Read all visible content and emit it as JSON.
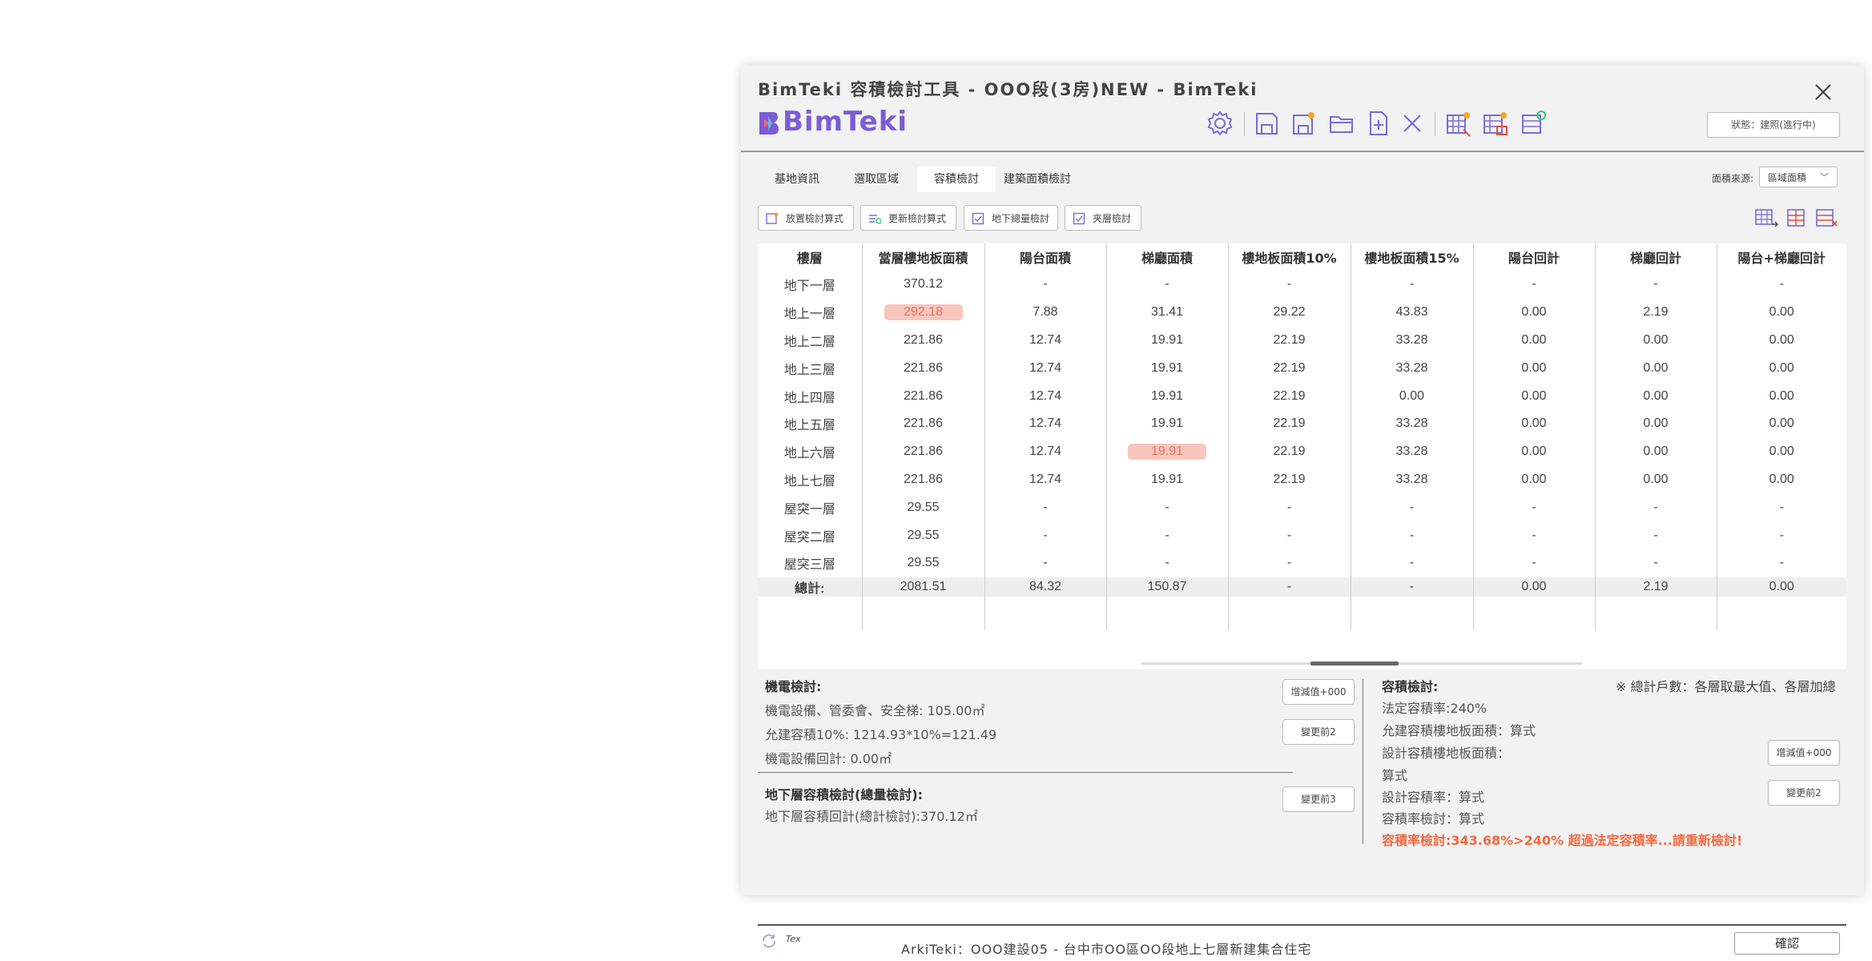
{
  "window": {
    "title": "BimTeki 容積檢討工具 - OOO段(3房)NEW - BimTeki",
    "logo_text": "BimTeki",
    "status": "狀態：建照(進行中)"
  },
  "tabs": [
    {
      "label": "基地資訊"
    },
    {
      "label": "選取區域"
    },
    {
      "label": "容積檢討"
    },
    {
      "label": "建築面積檢討"
    }
  ],
  "area_source": {
    "label": "面積來源:",
    "value": "區域面積"
  },
  "actions": [
    {
      "label": "放置檢討算式"
    },
    {
      "label": "更新檢討算式"
    },
    {
      "label": "地下總量檢討"
    },
    {
      "label": "夾層檢討"
    }
  ],
  "table": {
    "headers": [
      "樓層",
      "當層樓地板面積",
      "陽台面積",
      "梯廳面積",
      "樓地板面積10%",
      "樓地板面積15%",
      "陽台回計",
      "梯廳回計",
      "陽台+梯廳回計"
    ],
    "rows": [
      {
        "cells": [
          "地下一層",
          "370.12",
          "-",
          "-",
          "-",
          "-",
          "-",
          "-",
          "-"
        ]
      },
      {
        "cells": [
          "地上一層",
          "292.18",
          "7.88",
          "31.41",
          "29.22",
          "43.83",
          "0.00",
          "2.19",
          "0.00"
        ]
      },
      {
        "cells": [
          "地上二層",
          "221.86",
          "12.74",
          "19.91",
          "22.19",
          "33.28",
          "0.00",
          "0.00",
          "0.00"
        ]
      },
      {
        "cells": [
          "地上三層",
          "221.86",
          "12.74",
          "19.91",
          "22.19",
          "33.28",
          "0.00",
          "0.00",
          "0.00"
        ]
      },
      {
        "cells": [
          "地上四層",
          "221.86",
          "12.74",
          "19.91",
          "22.19",
          "0.00",
          "0.00",
          "0.00",
          "0.00"
        ]
      },
      {
        "cells": [
          "地上五層",
          "221.86",
          "12.74",
          "19.91",
          "22.19",
          "33.28",
          "0.00",
          "0.00",
          "0.00"
        ]
      },
      {
        "cells": [
          "地上六層",
          "221.86",
          "12.74",
          "19.91",
          "22.19",
          "33.28",
          "0.00",
          "0.00",
          "0.00"
        ]
      },
      {
        "cells": [
          "地上七層",
          "221.86",
          "12.74",
          "19.91",
          "22.19",
          "33.28",
          "0.00",
          "0.00",
          "0.00"
        ]
      },
      {
        "cells": [
          "屋突一層",
          "29.55",
          "-",
          "-",
          "-",
          "-",
          "-",
          "-",
          "-"
        ]
      },
      {
        "cells": [
          "屋突二層",
          "29.55",
          "-",
          "-",
          "-",
          "-",
          "-",
          "-",
          "-"
        ]
      },
      {
        "cells": [
          "屋突三層",
          "29.55",
          "-",
          "-",
          "-",
          "-",
          "-",
          "-",
          "-"
        ]
      }
    ],
    "total": [
      "總計:",
      "2081.51",
      "84.32",
      "150.87",
      "-",
      "-",
      "0.00",
      "2.19",
      "0.00"
    ]
  },
  "mep": {
    "title": "機電檢討:",
    "line1": "機電設備、管委會、安全梯: 105.00㎡",
    "line2": "允建容積10%: 1214.93*10%=121.49",
    "line3": "機電設備回計: 0.00㎡",
    "btn_add": "增減值+000",
    "btn_change": "變更前2"
  },
  "basement": {
    "title": "地下層容積檢討(總量檢討):",
    "line1": "地下層容積回計(總計檢討):370.12㎡",
    "btn_change": "變更前3"
  },
  "far": {
    "title": "容積檢討:",
    "note": "※ 總計戶數：各層取最大值、各層加總",
    "line1": "法定容積率:240%",
    "line2": "允建容積樓地板面積：算式",
    "line3": "設計容積樓地板面積：",
    "line4": "算式",
    "line5": "設計容積率：算式",
    "line6": "容積率檢討：算式",
    "warning": "容積率檢討:343.68%>240% 超過法定容積率...請重新檢討!",
    "btn_add": "增減值+000",
    "btn_change": "變更前2"
  },
  "footer": {
    "project": "ArkiTeki：OOO建設05 - 台中市OO區OO段地上七層新建集合住宅",
    "ok": "確認",
    "tex_label": "Tex"
  },
  "colors": {
    "accent": "#7b5cd6",
    "highlight_bg": "#f9c6bd",
    "highlight_text": "#e8735c",
    "warning": "#f2693f",
    "icon_orange": "#f5a623"
  }
}
